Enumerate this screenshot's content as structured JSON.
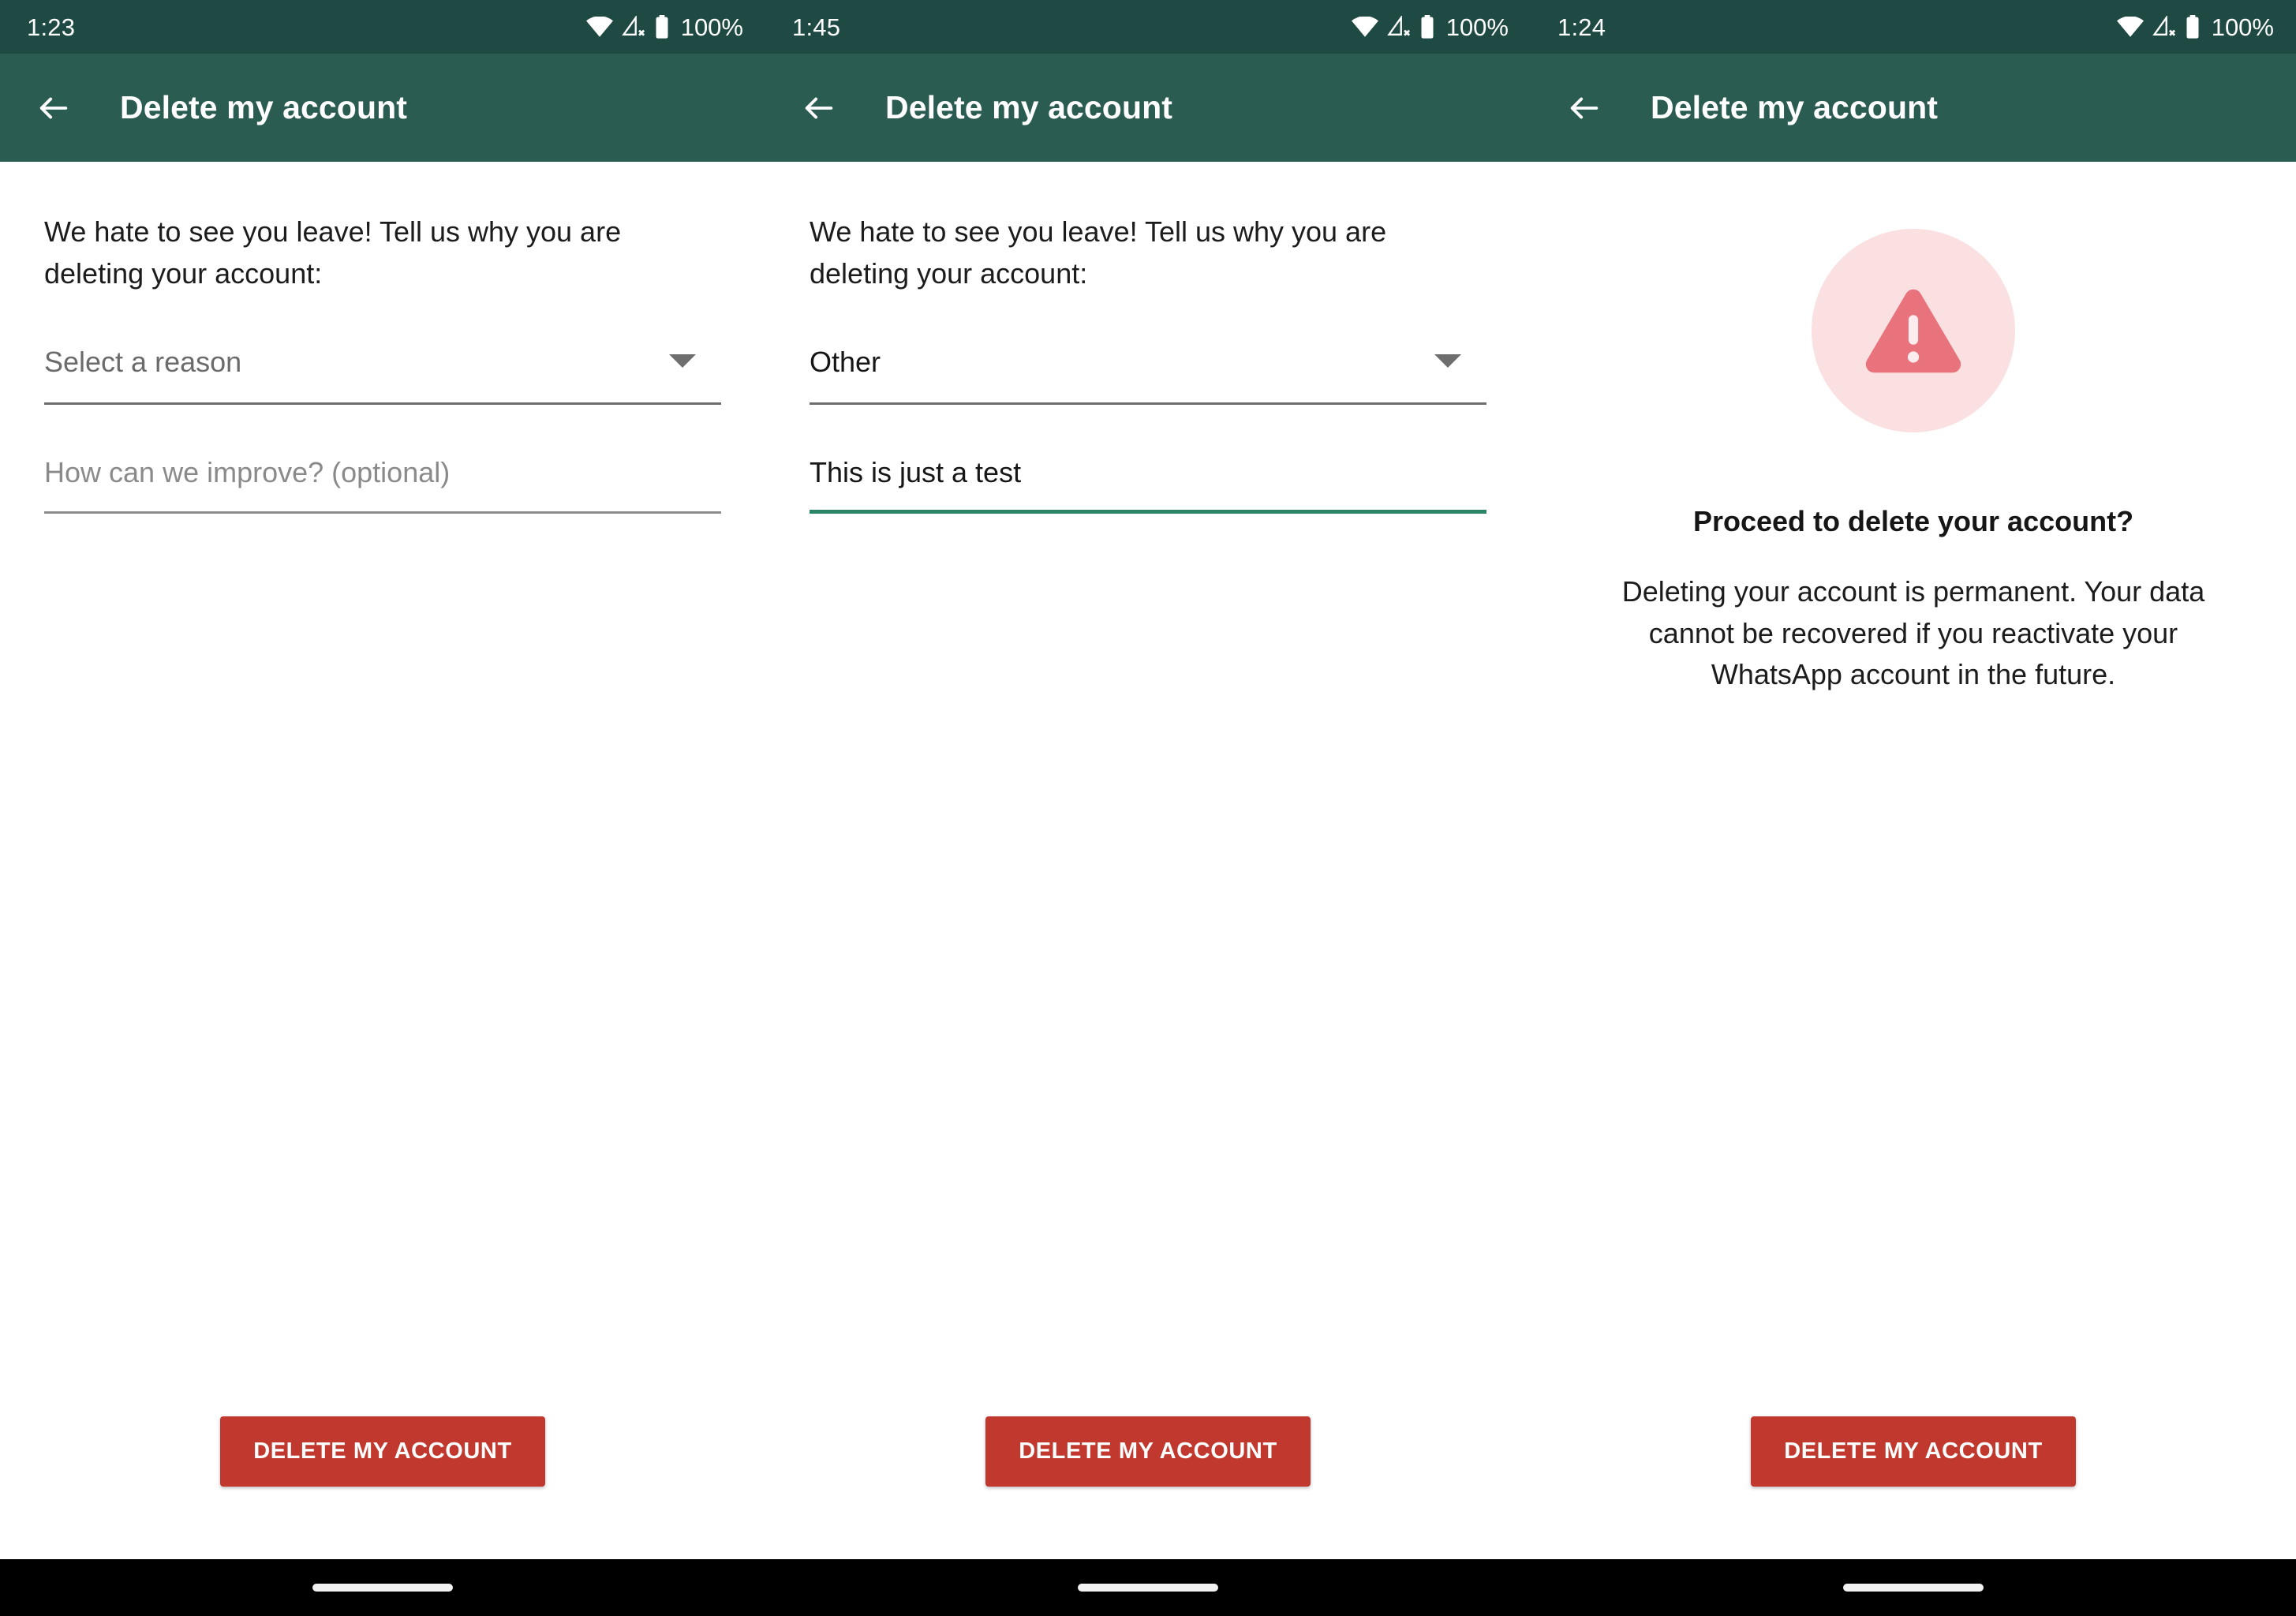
{
  "screens": [
    {
      "id": "step-select-reason",
      "status_bar": {
        "time": "1:23",
        "battery_pct": "100%",
        "icons": [
          "wifi-icon",
          "cellular-off-icon",
          "battery-full-icon"
        ]
      },
      "app_bar": {
        "back_icon": "arrow-left-icon",
        "title": "Delete my account"
      },
      "form": {
        "intro": "We hate to see you leave! Tell us why you are deleting your account:",
        "reason_select": {
          "value": "Select a reason",
          "placeholder": "Select a reason",
          "is_placeholder": true,
          "caret_icon": "chevron-down-icon"
        },
        "feedback_input": {
          "value": "",
          "placeholder": "How can we improve? (optional)",
          "is_placeholder": true,
          "focused": false
        }
      },
      "primary_button": "DELETE MY ACCOUNT"
    },
    {
      "id": "step-other-reason-filled",
      "status_bar": {
        "time": "1:45",
        "battery_pct": "100%",
        "icons": [
          "wifi-icon",
          "cellular-off-icon",
          "battery-full-icon"
        ]
      },
      "app_bar": {
        "back_icon": "arrow-left-icon",
        "title": "Delete my account"
      },
      "form": {
        "intro": "We hate to see you leave! Tell us why you are deleting your account:",
        "reason_select": {
          "value": "Other",
          "placeholder": "Select a reason",
          "is_placeholder": false,
          "caret_icon": "chevron-down-icon"
        },
        "feedback_input": {
          "value": "This is just a test",
          "placeholder": "How can we improve? (optional)",
          "is_placeholder": false,
          "focused": true
        }
      },
      "primary_button": "DELETE MY ACCOUNT"
    },
    {
      "id": "step-confirm",
      "status_bar": {
        "time": "1:24",
        "battery_pct": "100%",
        "icons": [
          "wifi-icon",
          "cellular-off-icon",
          "battery-full-icon"
        ]
      },
      "app_bar": {
        "back_icon": "arrow-left-icon",
        "title": "Delete my account"
      },
      "confirm": {
        "warning_icon": "warning-triangle-icon",
        "title": "Proceed to delete your account?",
        "body": "Deleting your account is permanent. Your data cannot be recovered if you reactivate your WhatsApp account in the future."
      },
      "primary_button": "DELETE MY ACCOUNT"
    }
  ],
  "colors": {
    "status_bar": "#1f4a43",
    "app_bar": "#2b5c52",
    "accent_green": "#2d8567",
    "danger_red": "#c1392e",
    "warning_circle_bg": "#fbe0e1",
    "warning_triangle": "#e8737c",
    "nav_bar": "#000000"
  }
}
